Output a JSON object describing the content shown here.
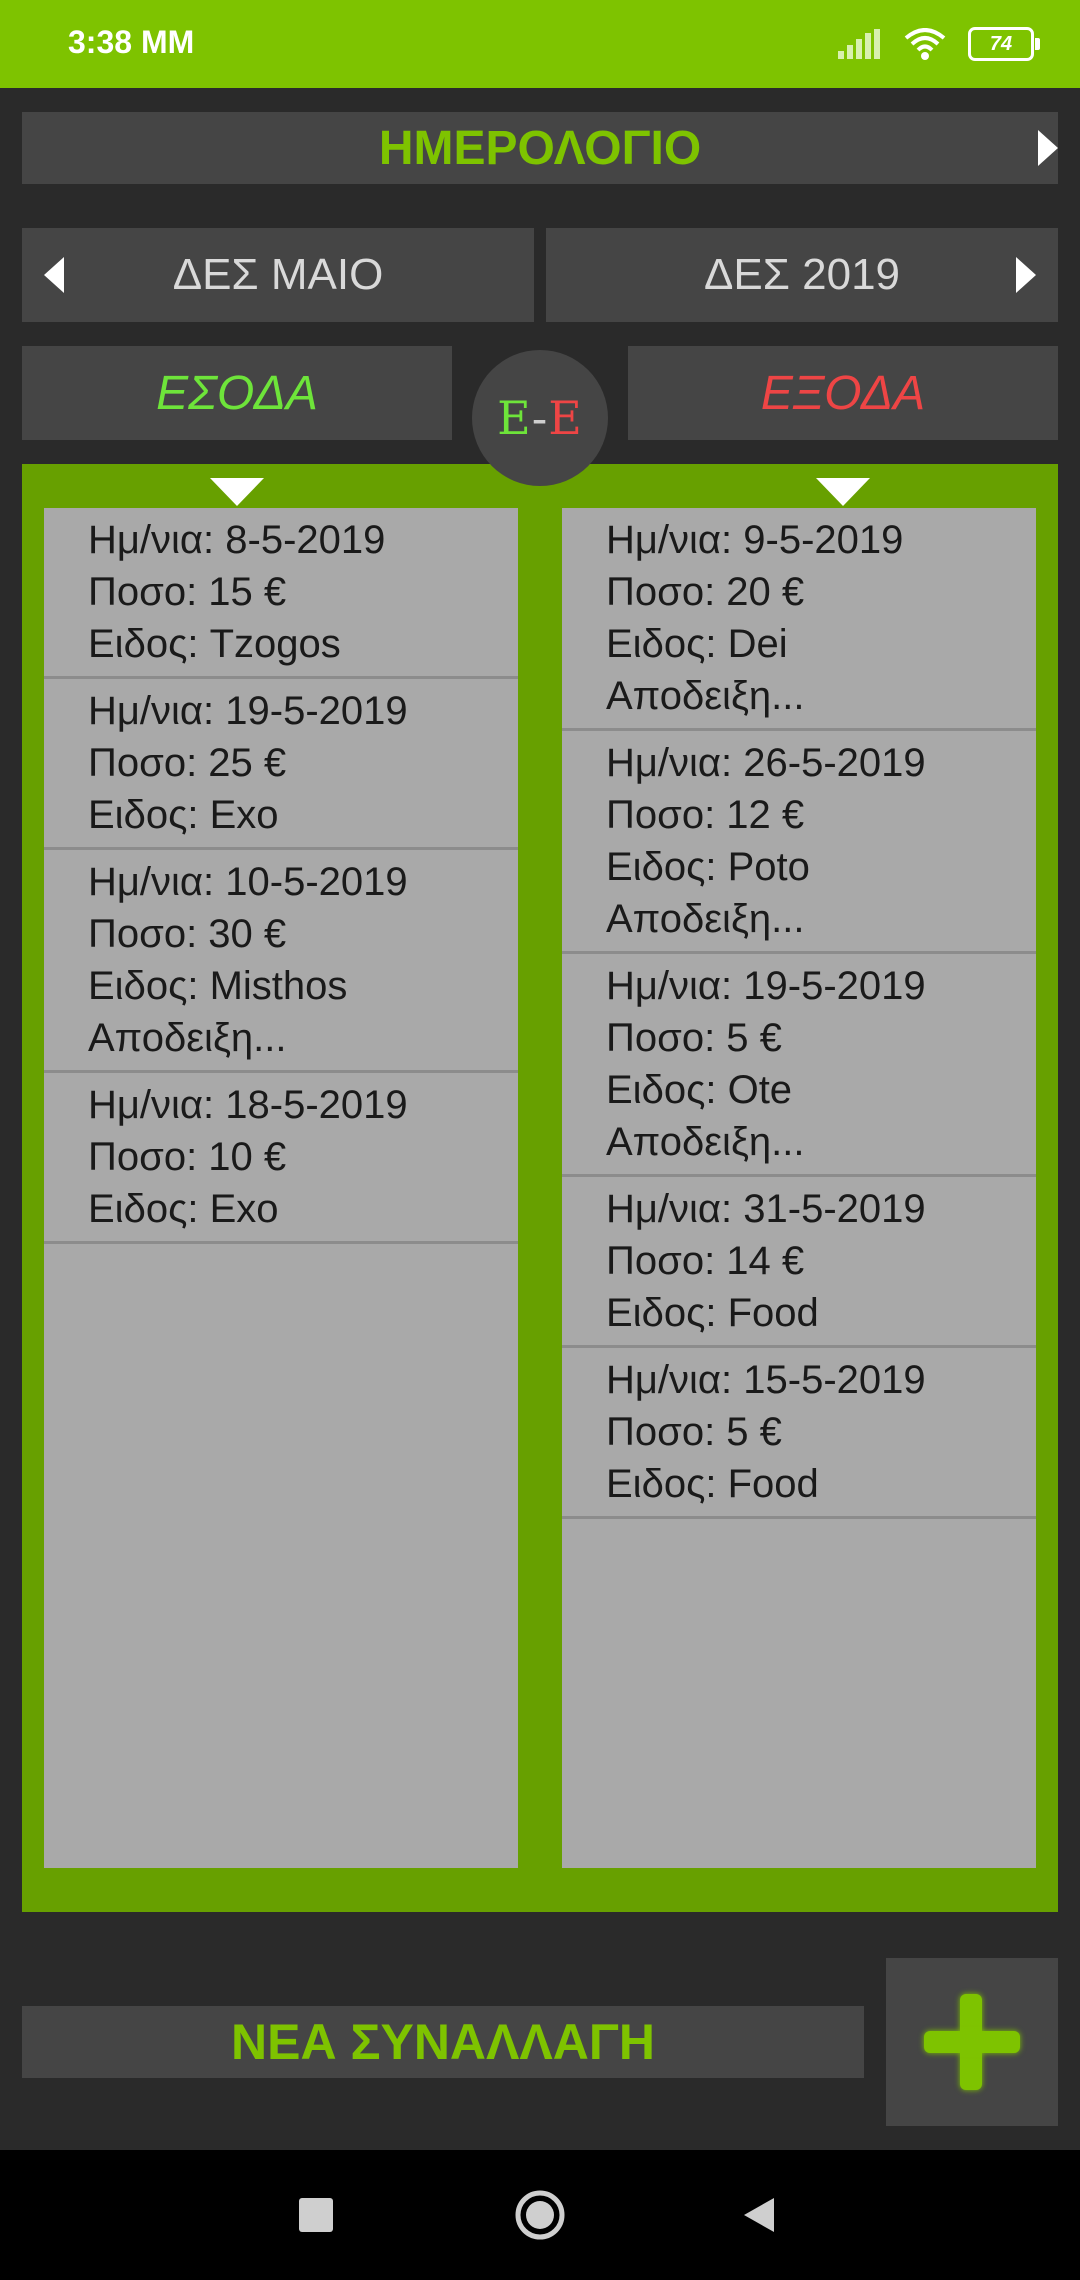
{
  "status": {
    "time": "3:38 MM",
    "battery": "74"
  },
  "header": {
    "title": "ΗΜΕΡΟΛΟΓΙΟ"
  },
  "period": {
    "month_label": "ΔΕΣ ΜΑΙΟ",
    "year_label": "ΔΕΣ 2019"
  },
  "tabs": {
    "income_label": "ΕΣΟΔΑ",
    "expense_label": "ΕΞΟΔΑ",
    "switch_left": "Ε",
    "switch_sep": "-",
    "switch_right": "Ε"
  },
  "colors": {
    "accent": "#7ec300",
    "income": "#6ee43a",
    "expense": "#ee4545"
  },
  "income": [
    {
      "date": "Ημ/νια: 8-5-2019",
      "amount": "Ποσο: 15 €",
      "type": "Ειδος: Tzogos"
    },
    {
      "date": "Ημ/νια: 19-5-2019",
      "amount": "Ποσο: 25 €",
      "type": "Ειδος: Exo"
    },
    {
      "date": "Ημ/νια: 10-5-2019",
      "amount": "Ποσο: 30 €",
      "type": "Ειδος: Misthos",
      "receipt": "Αποδειξη..."
    },
    {
      "date": "Ημ/νια: 18-5-2019",
      "amount": "Ποσο: 10 €",
      "type": "Ειδος: Exo"
    }
  ],
  "expenses": [
    {
      "date": "Ημ/νια: 9-5-2019",
      "amount": "Ποσο: 20 €",
      "type": "Ειδος: Dei",
      "receipt": "Αποδειξη..."
    },
    {
      "date": "Ημ/νια: 26-5-2019",
      "amount": "Ποσο: 12 €",
      "type": "Ειδος: Poto",
      "receipt": "Αποδειξη..."
    },
    {
      "date": "Ημ/νια: 19-5-2019",
      "amount": "Ποσο: 5 €",
      "type": "Ειδος: Ote",
      "receipt": "Αποδειξη..."
    },
    {
      "date": "Ημ/νια: 31-5-2019",
      "amount": "Ποσο: 14 €",
      "type": "Ειδος: Food"
    },
    {
      "date": "Ημ/νια: 15-5-2019",
      "amount": "Ποσο: 5 €",
      "type": "Ειδος: Food"
    }
  ],
  "footer": {
    "new_transaction_label": "ΝΕΑ ΣΥΝΑΛΛΑΓΗ"
  }
}
